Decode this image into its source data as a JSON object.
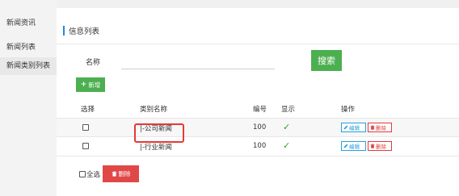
{
  "sidebar": {
    "section_title": "新闻资讯",
    "items": [
      {
        "label": "新闻列表",
        "active": false
      },
      {
        "label": "新闻类别列表",
        "active": true
      }
    ]
  },
  "main": {
    "title": "信息列表",
    "filter": {
      "label": "名称",
      "value": "",
      "placeholder": ""
    },
    "search_label": "搜索",
    "add_label": "新增",
    "table": {
      "headers": [
        "选择",
        "类别名称",
        "编号",
        "显示",
        "操作"
      ],
      "rows": [
        {
          "checked": false,
          "name": "|-公司新闻",
          "number": "100",
          "visible": true,
          "edit_label": "编辑",
          "delete_label": "删除"
        },
        {
          "checked": false,
          "name": "|-行业新闻",
          "number": "100",
          "visible": true,
          "edit_label": "编辑",
          "delete_label": "删除"
        }
      ]
    },
    "select_all_label": "全选",
    "bulk_delete_label": "删除"
  },
  "icons": {
    "check": "checkmark-icon",
    "edit": "pencil-icon",
    "delete": "trash-icon",
    "add": "plus-icon"
  },
  "colors": {
    "accent": "#1e88e5",
    "primary_green": "#4caf50",
    "danger_red": "#e04848",
    "edit_blue": "#26a0da",
    "highlight": "#e53935"
  }
}
